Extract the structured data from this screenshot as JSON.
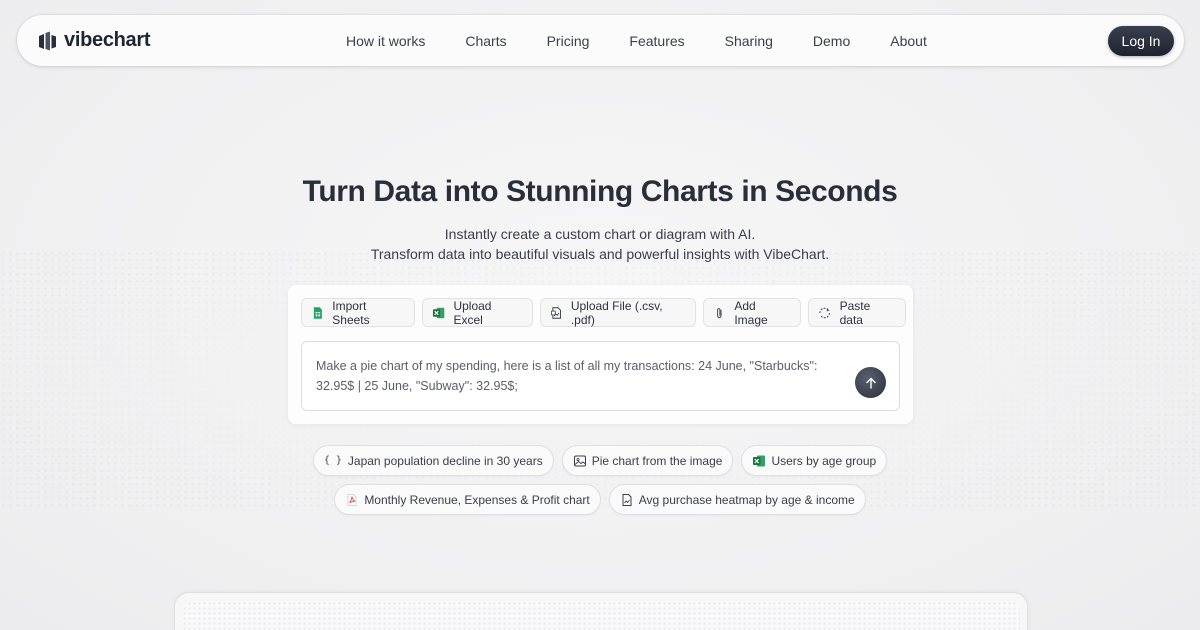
{
  "nav": {
    "logo_text": "vibechart",
    "menu": [
      "How it works",
      "Charts",
      "Pricing",
      "Features",
      "Sharing",
      "Demo",
      "About"
    ],
    "login_label": "Log In"
  },
  "hero": {
    "title": "Turn Data into Stunning Charts in Seconds",
    "subtitle_line1": "Instantly create a custom chart or diagram with AI.",
    "subtitle_line2": "Transform data into beautiful visuals and powerful insights with VibeChart."
  },
  "actions": [
    {
      "label": "Import Sheets",
      "icon": "google-sheets-icon"
    },
    {
      "label": "Upload Excel",
      "icon": "excel-icon"
    },
    {
      "label": "Upload File (.csv, .pdf)",
      "icon": "file-upload-icon"
    },
    {
      "label": "Add Image",
      "icon": "paperclip-icon"
    },
    {
      "label": "Paste data",
      "icon": "paste-icon"
    }
  ],
  "prompt": {
    "value": "Make a pie chart of my spending, here is a list of all my transactions: 24 June, \"Starbucks\": 32.95$ | 25 June, \"Subway\": 32.95$;",
    "send_icon": "arrow-up-icon"
  },
  "suggestions": {
    "row1": [
      {
        "label": "Japan population decline in 30 years",
        "icon": "code-braces-icon"
      },
      {
        "label": "Pie chart from the image",
        "icon": "image-icon"
      },
      {
        "label": "Users by age group",
        "icon": "excel-icon"
      }
    ],
    "row2": [
      {
        "label": "Monthly Revenue, Expenses & Profit chart",
        "icon": "pdf-icon"
      },
      {
        "label": "Avg purchase heatmap by age & income",
        "icon": "file-chart-icon"
      }
    ]
  },
  "colors": {
    "accent_dark": "#2a2e3a",
    "sheets_green": "#23a566",
    "excel_green": "#1d7044",
    "pdf_red": "#e2453c"
  }
}
